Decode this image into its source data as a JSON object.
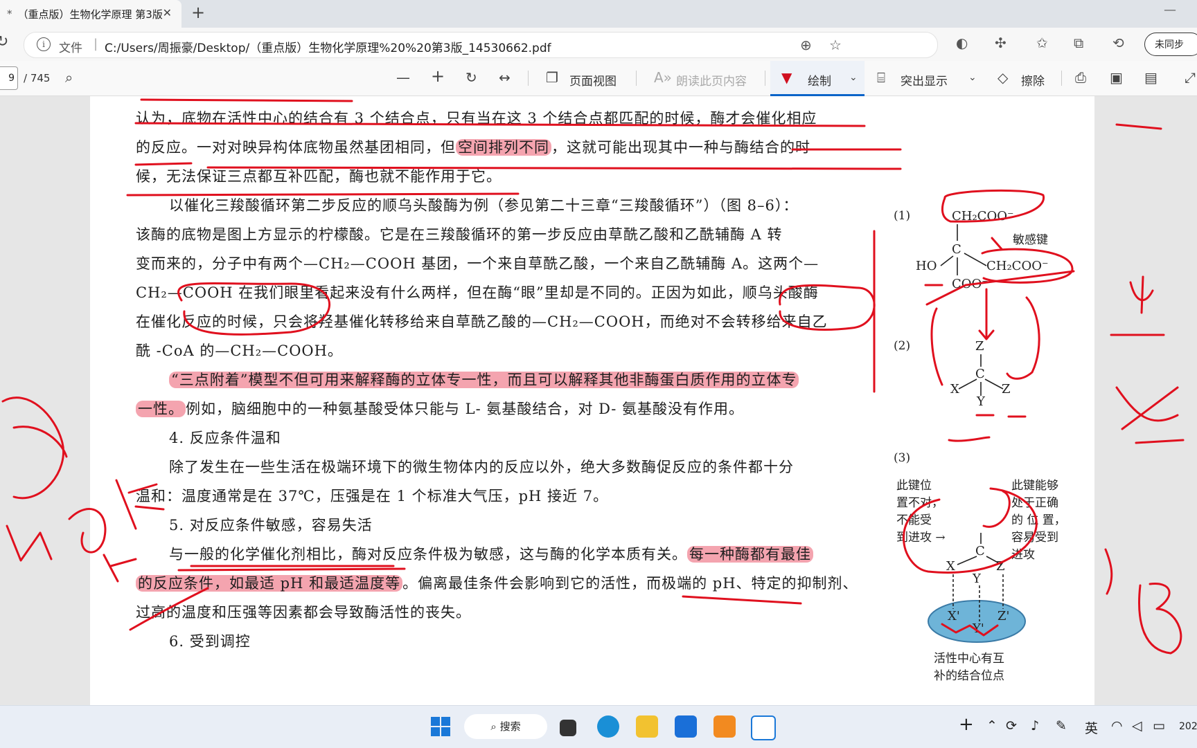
{
  "tab": {
    "modified_mark": "*",
    "title": "（重点版）生物化学原理 第3版"
  },
  "address": {
    "file_label": "文件",
    "url": "C:/Users/周振豪/Desktop/（重点版）生物化学原理%20%20第3版_14530662.pdf"
  },
  "sync_label": "未同步",
  "pdf_toolbar": {
    "page_current": "9",
    "page_total": "/ 745",
    "page_view": "页面视图",
    "read_aloud": "朗读此页内容",
    "draw": "绘制",
    "highlight": "突出显示",
    "erase": "擦除"
  },
  "content": {
    "lines": [
      "认为，底物在活性中心的结合有 3 个结合点，只有当在这 3 个结合点都匹配的时候，酶才会催化相应",
      "一对对映异构体底物虽然基团相同，但",
      "，这就可能出现其中一种与酶结合的时",
      "候，无法保证三点都互补匹配，酶也就不能作用于它。",
      "以催化三羧酸循环第二步反应的顺乌头酸酶为例（参见第二十三章“三羧酸循环”）（图 8–6）：",
      "该酶的底物是图上方显示的柠檬酸。它是在三羧酸循环的第一步反应由草酰乙酸和乙酰辅酶 A 转",
      "变而来的，分子中有两个—CH₂—COOH 基团，一个来自草酰乙酸，一个来自乙酰辅酶 A。这两个—",
      "CH₂—COOH 在我们眼里看起来没有什么两样，但在酶“眼”里却是不同的。正因为如此，顺乌头酸酶",
      "在催化反应的时候，只会将羟基催化转移给来自草酰乙酸的—CH₂—COOH，而绝对不会转移给来自乙",
      "酰 -CoA 的—CH₂—COOH。",
      "“三点附着”模型不但可用来解释酶的立体专一性，而且可以解释其他非酶蛋白质作用的立体专",
      "一性。",
      "例如，脑细胞中的一种氨基酸受体只能与 L- 氨基酸结合，对 D- 氨基酸没有作用。",
      "4. 反应条件温和",
      "除了发生在一些生活在极端环境下的微生物体内的反应以外，绝大多数酶促反应的条件都十分",
      "温和：温度通常是在 37℃，压强是在 1 个标准大气压，pH 接近 7。",
      "5. 对反应条件敏感，容易失活",
      "与一般的化学催化剂相比，酶对反应条件极为敏感，这与酶的化学本质有关。",
      "每一种酶都有最佳",
      "的反应条件，如最适 pH 和最适温度等",
      "。偏离最佳条件会影响到它的活性，而极端的 pH、特定的抑制剂、",
      "过高的温度和压强等因素都会导致酶活性的丧失。",
      "6. 受到调控",
      "的反应。",
      "空间排列不同"
    ]
  },
  "figure": {
    "label1": "(1)",
    "label2": "(2)",
    "label3": "(3)",
    "ch2coo_top": "CH₂COO⁻",
    "ch2coo_mid": "CH₂COO⁻",
    "c": "C",
    "ho": "HO",
    "coo": "COO⁻",
    "sensitive_bond": "敏感键",
    "z": "Z",
    "x": "X",
    "y": "Y",
    "left_caption": [
      "此键位",
      "置不对，",
      "不能受",
      "到进攻 →"
    ],
    "right_caption": [
      "此键能够",
      "处于正确",
      "的 位 置，",
      "容易受到",
      "进攻"
    ],
    "site_x": "X'",
    "site_y": "Y'",
    "site_z": "Z'",
    "bottom_caption": [
      "活性中心有互",
      "补的结合位点"
    ]
  },
  "taskbar": {
    "search": "搜索",
    "ime": "英",
    "year_fragment": "202"
  },
  "colors": {
    "ink": "#e0101e",
    "highlight": "#eb5a6e",
    "accent": "#0a64c8"
  }
}
